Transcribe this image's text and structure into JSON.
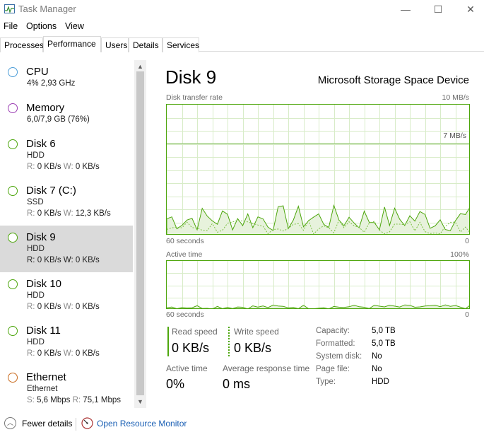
{
  "window": {
    "title": "Task Manager",
    "min_icon": "—",
    "max_icon": "☐",
    "close_icon": "✕"
  },
  "menu": [
    "File",
    "Options",
    "View"
  ],
  "tabs": [
    "Processes",
    "Performance",
    "Users",
    "Details",
    "Services"
  ],
  "active_tab": "Performance",
  "sidebar": {
    "items": [
      {
        "name": "CPU",
        "line1": "4% 2,93 GHz",
        "color": "#4d9ed8"
      },
      {
        "name": "Memory",
        "line1": "6,0/7,9 GB (76%)",
        "color": "#9c3fb3"
      },
      {
        "name": "Disk 6",
        "line1": "HDD",
        "r_label": "R:",
        "r_val": "0 KB/s",
        "w_label": "W:",
        "w_val": "0 KB/s",
        "color": "#4da60c"
      },
      {
        "name": "Disk 7 (C:)",
        "line1": "SSD",
        "r_label": "R:",
        "r_val": "0 KB/s",
        "w_label": "W:",
        "w_val": "12,3 KB/s",
        "color": "#4da60c"
      },
      {
        "name": "Disk 9",
        "line1": "HDD",
        "r_label": "R:",
        "r_val": "0 KB/s",
        "w_label": "W:",
        "w_val": "0 KB/s",
        "color": "#4da60c"
      },
      {
        "name": "Disk 10",
        "line1": "HDD",
        "r_label": "R:",
        "r_val": "0 KB/s",
        "w_label": "W:",
        "w_val": "0 KB/s",
        "color": "#4da60c"
      },
      {
        "name": "Disk 11",
        "line1": "HDD",
        "r_label": "R:",
        "r_val": "0 KB/s",
        "w_label": "W:",
        "w_val": "0 KB/s",
        "color": "#4da60c"
      },
      {
        "name": "Ethernet",
        "line1": "Ethernet",
        "r_label": "S:",
        "r_val": "5,6 Mbps",
        "w_label": "R:",
        "w_val": "75,1 Mbps",
        "color": "#c86a1e"
      }
    ],
    "selected": "Disk 9"
  },
  "main": {
    "title": "Disk 9",
    "device": "Microsoft Storage Space Device",
    "transfer_label": "Disk transfer rate",
    "transfer_max": "10 MB/s",
    "transfer_marker": "7 MB/s",
    "transfer_time": "60 seconds",
    "transfer_zero": "0",
    "active_label": "Active time",
    "active_max": "100%",
    "active_time": "60 seconds",
    "active_zero": "0",
    "read_label": "Read speed",
    "read_value": "0 KB/s",
    "write_label": "Write speed",
    "write_value": "0 KB/s",
    "active_time_label": "Active time",
    "active_time_value": "0%",
    "avg_resp_label": "Average response time",
    "avg_resp_value": "0 ms",
    "details": [
      {
        "key": "Capacity:",
        "val": "5,0 TB"
      },
      {
        "key": "Formatted:",
        "val": "5,0 TB"
      },
      {
        "key": "System disk:",
        "val": "No"
      },
      {
        "key": "Page file:",
        "val": "No"
      },
      {
        "key": "Type:",
        "val": "HDD"
      }
    ],
    "accent": "#4da60c"
  },
  "footer": {
    "fewer_details": "Fewer details",
    "resource_monitor": "Open Resource Monitor"
  }
}
